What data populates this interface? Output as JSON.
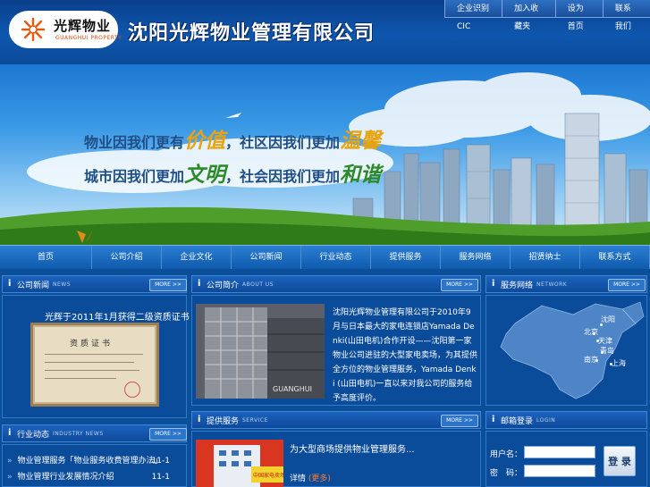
{
  "header": {
    "logo_cn": "光辉物业",
    "logo_en": "GUANGHUI PROPERTY",
    "company_title": "沈阳光辉物业管理有限公司",
    "top_links": [
      "企业识别CIC",
      "加入收藏夹",
      "设为首页",
      "联系我们"
    ]
  },
  "banner": {
    "slogan_1_a": "物业因我们更有",
    "slogan_1_b": "价值",
    "slogan_1_c": "，社区因我们更加",
    "slogan_1_d": "温馨",
    "slogan_2_a": "城市因我们更加",
    "slogan_2_b": "文明",
    "slogan_2_c": "，社会因我们更加",
    "slogan_2_d": "和谐"
  },
  "nav": [
    "首页",
    "公司介绍",
    "企业文化",
    "公司新闻",
    "行业动态",
    "提供服务",
    "服务网络",
    "招贤纳士",
    "联系方式"
  ],
  "panels": {
    "news": {
      "title": "公司新闻",
      "en": "NEWS",
      "more": "MORE >>",
      "cert_caption": "光辉于2011年1月获得二级资质证书",
      "cert_title": "资质证书"
    },
    "about": {
      "title": "公司简介",
      "en": "ABOUT US",
      "more": "MORE >>",
      "photo_sign": "GUANGHUI",
      "text": "沈阳光辉物业管理有限公司于2010年9月与日本最大的家电连锁店Yamada Denki(山田电机)合作开设——沈阳第一家物业公司进驻的大型家电卖场，为其提供全方位的物业管理服务，Yamada Denki (山田电机)一直以来对我公司的服务给予高度评价。"
    },
    "network": {
      "title": "服务网络",
      "en": "NETWORK",
      "more": "MORE >>",
      "cities": [
        "沈阳",
        "北京",
        "天津",
        "青岛",
        "南京",
        "上海"
      ]
    },
    "industry": {
      "title": "行业动态",
      "en": "INDUSTRY NEWS",
      "more": "MORE >>",
      "items": [
        {
          "title": "物业管理服务「物业服务收费管理办法」",
          "date": "11-1"
        },
        {
          "title": "物业管理行业发展情况介绍",
          "date": "11-1"
        }
      ]
    },
    "services": {
      "title": "提供服务",
      "en": "SERVICE",
      "more": "MORE >>",
      "headline": "为大型商场提供物业管理服务...",
      "sub_a": "详情",
      "sub_b": "(更多)",
      "photo_badge": "中国家电卖场 光辉物业"
    },
    "login": {
      "title": "邮箱登录",
      "en": "LOGIN",
      "user_label": "用户名：",
      "pass_label": "密　码：",
      "button": "登 录"
    }
  },
  "colors": {
    "page_bg": "#0c4f99",
    "accent_gold": "#e8a311",
    "accent_green": "#2c8a2a"
  },
  "icons": {
    "logo": "sun-logo-icon",
    "panel": "info-i-icon"
  }
}
